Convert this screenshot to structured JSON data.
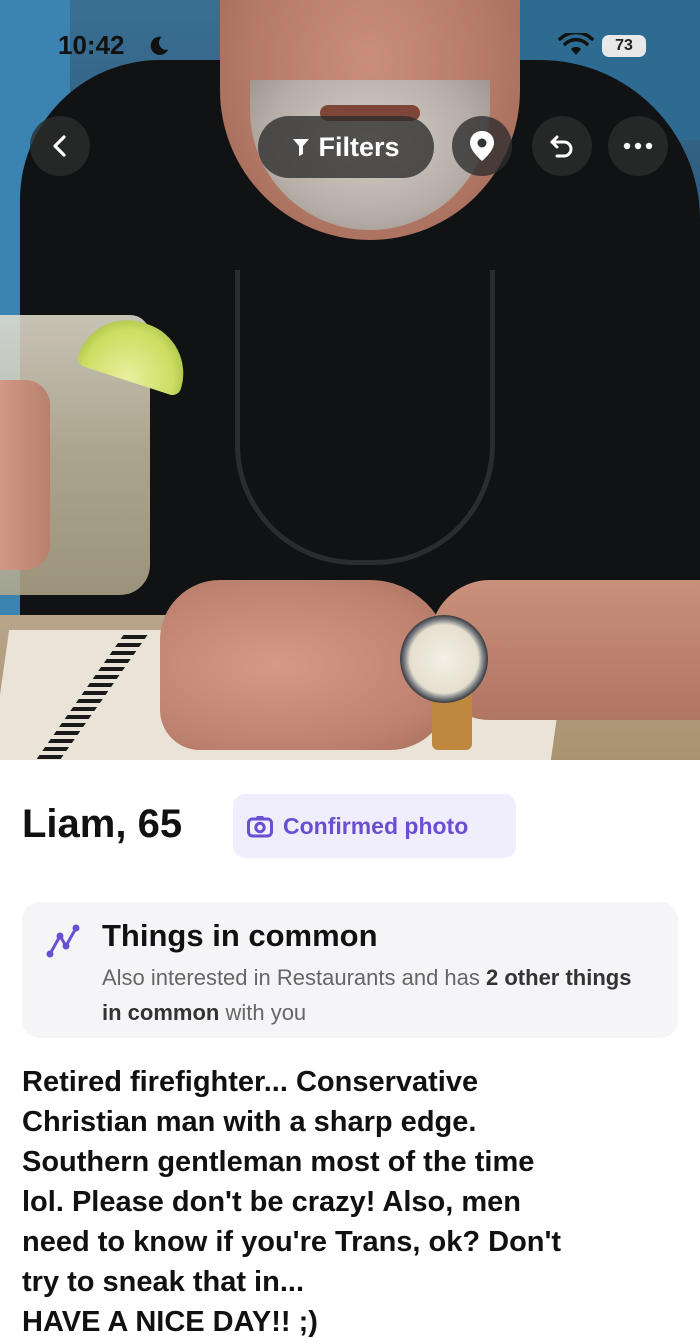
{
  "status_bar": {
    "time": "10:42",
    "battery": "73",
    "icons": [
      "moon-icon",
      "wifi-icon",
      "battery-icon"
    ]
  },
  "top_bar": {
    "filters_label": "Filters",
    "icons": [
      "back-chevron-icon",
      "filter-icon",
      "location-pin-icon",
      "undo-icon",
      "more-icon"
    ]
  },
  "profile": {
    "name_age": "Liam, 65",
    "confirmed_label": "Confirmed photo"
  },
  "common": {
    "title": "Things in common",
    "desc_prefix": "Also interested in Restaurants and has ",
    "desc_bold": "2 other things in common",
    "desc_suffix": " with you"
  },
  "bio": "Retired firefighter...  Conservative\nChristian man with a sharp edge.\nSouthern gentleman most of the time\nlol. Please don't be crazy! Also, men\nneed to know if you're Trans, ok? Don't\ntry to sneak that in...\nHAVE A NICE DAY!!  ;)",
  "colors": {
    "accent_purple": "#6b4fd3",
    "badge_bg": "#f0eefc",
    "card_bg": "#f5f5f8",
    "overlay_button": "#2d2d2d"
  }
}
